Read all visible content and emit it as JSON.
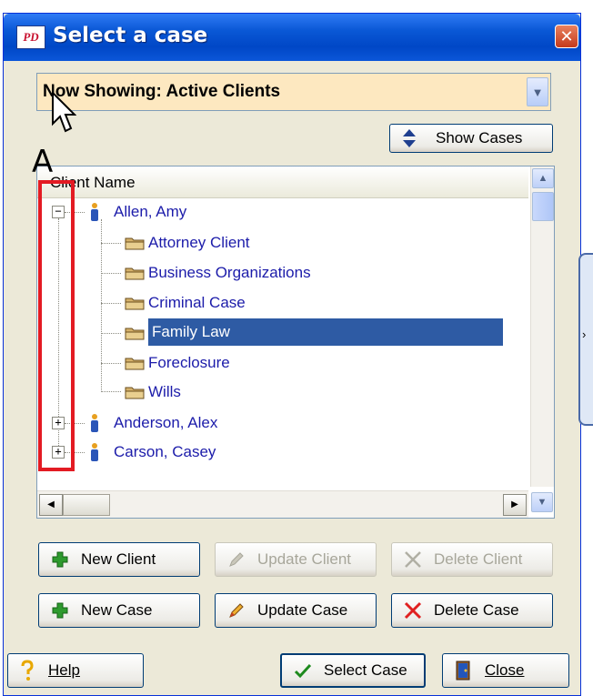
{
  "window": {
    "title": "Select a case",
    "icon_text": "PD"
  },
  "filter": {
    "label": "Now Showing: Active Clients"
  },
  "show_cases": {
    "label": "Show Cases"
  },
  "annotation": {
    "letter": "A"
  },
  "list": {
    "header": "Client Name",
    "clients": [
      {
        "name": "Allen, Amy",
        "expanded": true,
        "cases": [
          {
            "name": "Attorney Client",
            "selected": false
          },
          {
            "name": "Business Organizations",
            "selected": false
          },
          {
            "name": "Criminal Case",
            "selected": false
          },
          {
            "name": "Family Law",
            "selected": true
          },
          {
            "name": "Foreclosure",
            "selected": false
          },
          {
            "name": "Wills",
            "selected": false
          }
        ]
      },
      {
        "name": "Anderson, Alex",
        "expanded": false
      },
      {
        "name": "Carson, Casey",
        "expanded": false
      }
    ]
  },
  "buttons": {
    "new_client": {
      "label": "New Client",
      "enabled": true
    },
    "update_client": {
      "label": "Update Client",
      "enabled": false
    },
    "delete_client": {
      "label": "Delete Client",
      "enabled": false
    },
    "new_case": {
      "label": "New Case",
      "enabled": true
    },
    "update_case": {
      "label": "Update Case",
      "enabled": true
    },
    "delete_case": {
      "label": "Delete Case",
      "enabled": true
    },
    "help": {
      "label": "Help"
    },
    "select_case": {
      "label": "Select Case"
    },
    "close": {
      "label": "Close"
    }
  },
  "colors": {
    "selection": "#2e5ba4",
    "link_text": "#1c1caa",
    "combo_bg": "#fde8c0",
    "annotation_red": "#e31b23"
  }
}
